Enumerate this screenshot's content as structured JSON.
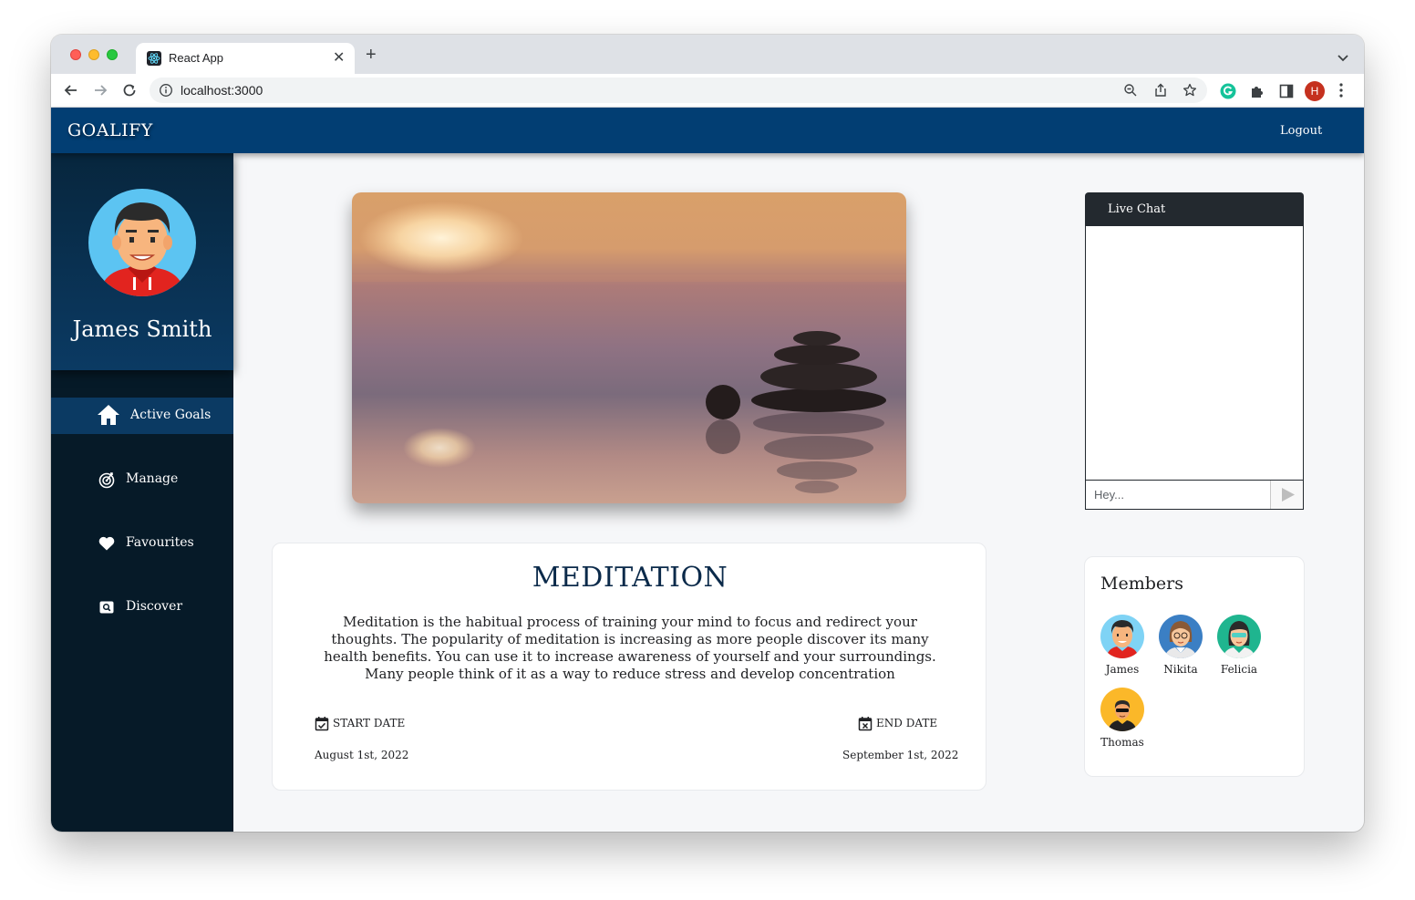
{
  "browser": {
    "tab_title": "React App",
    "url": "localhost:3000",
    "profile_initial": "H"
  },
  "app": {
    "brand": "GOALIFY",
    "logout_label": "Logout"
  },
  "sidebar": {
    "user_name": "James Smith",
    "items": [
      {
        "label": "Active Goals",
        "icon": "home-icon",
        "active": true
      },
      {
        "label": "Manage",
        "icon": "target-icon",
        "active": false
      },
      {
        "label": "Favourites",
        "icon": "heart-icon",
        "active": false
      },
      {
        "label": "Discover",
        "icon": "search-box-icon",
        "active": false
      }
    ]
  },
  "goal": {
    "title": "MEDITATION",
    "description": "Meditation is the habitual process of training your mind to focus and redirect your thoughts. The popularity of meditation is increasing as more people discover its many health benefits. You can use it to increase awareness of yourself and your surroundings. Many people think of it as a way to reduce stress and develop concentration",
    "start_label": "START DATE",
    "start_value": "August 1st, 2022",
    "end_label": "END DATE",
    "end_value": "September 1st, 2022"
  },
  "chat": {
    "title": "Live Chat",
    "input_placeholder": "Hey..."
  },
  "members": {
    "title": "Members",
    "list": [
      {
        "name": "James",
        "bg": "#7fd3f5"
      },
      {
        "name": "Nikita",
        "bg": "#3b7fc4"
      },
      {
        "name": "Felicia",
        "bg": "#1fb58f"
      },
      {
        "name": "Thomas",
        "bg": "#fbb829"
      }
    ]
  },
  "colors": {
    "header": "#023e73",
    "sidebar": "#061a28",
    "active_nav": "#0b3a63",
    "chat_header": "#23292f"
  }
}
